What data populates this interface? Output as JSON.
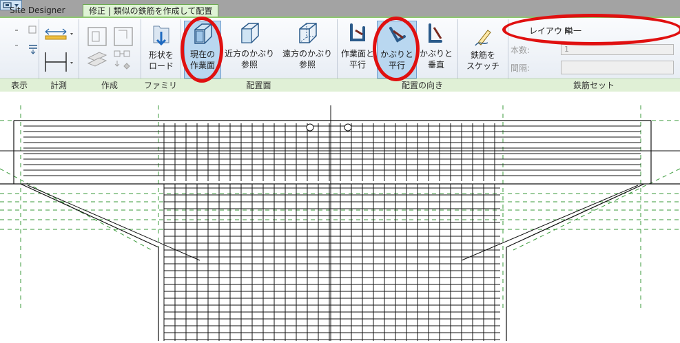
{
  "tabs": {
    "site_designer": "Site Designer",
    "context": "修正 | 類似の鉄筋を作成して配置"
  },
  "ribbon": {
    "load_family_label1": "形状を",
    "load_family_label2": "ロード",
    "current_workplane1": "現在の",
    "current_workplane2": "作業面",
    "near_cover1": "近方のかぶり",
    "near_cover2": "参照",
    "far_cover1": "遠方のかぶり",
    "far_cover2": "参照",
    "parallel_wp1": "作業面と",
    "parallel_wp2": "平行",
    "parallel_cover1": "かぶりと",
    "parallel_cover2": "平行",
    "perp_cover1": "かぶりと",
    "perp_cover2": "垂直",
    "sketch1": "鉄筋を",
    "sketch2": "スケッチ"
  },
  "panels": {
    "view": "表示",
    "measure": "計測",
    "create": "作成",
    "family": "ファミリ",
    "placement_plane": "配置面",
    "placement_orientation": "配置の向き",
    "rebar_set": "鉄筋セット"
  },
  "rebar_set": {
    "layout_label": "レイアウト:",
    "layout_value": "単一",
    "quantity_label": "本数:",
    "quantity_value": "1",
    "spacing_label": "間隔:",
    "spacing_value": ""
  },
  "colors": {
    "highlight": "#e01010",
    "selected": "#b9d7f0",
    "context_tab": "#dff3d5",
    "reference_line": "#3a9a3a"
  }
}
